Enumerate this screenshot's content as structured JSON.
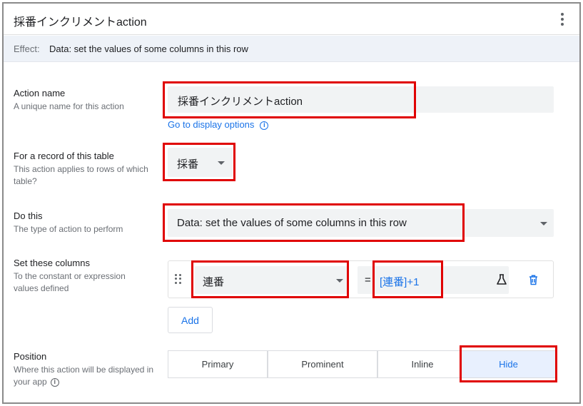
{
  "header": {
    "title": "採番インクリメントaction"
  },
  "effect": {
    "label": "Effect:",
    "value": "Data: set the values of some columns in this row"
  },
  "action_name": {
    "title": "Action name",
    "desc": "A unique name for this action",
    "value": "採番インクリメントaction",
    "link": "Go to display options",
    "link_icon": "info-icon"
  },
  "table": {
    "title": "For a record of this table",
    "desc": "This action applies to rows of which table?",
    "value": "採番"
  },
  "do_this": {
    "title": "Do this",
    "desc": "The type of action to perform",
    "value": "Data: set the values of some columns in this row"
  },
  "set_columns": {
    "title": "Set these columns",
    "desc": "To the constant or expression values defined",
    "column": "連番",
    "equals": "=",
    "expression": "[連番]+1",
    "expression_color": "#1a73e8",
    "add_label": "Add"
  },
  "position": {
    "title": "Position",
    "desc": "Where this action will be displayed in your app",
    "options": [
      "Primary",
      "Prominent",
      "Inline",
      "Hide"
    ],
    "selected": "Hide"
  },
  "colors": {
    "highlight": "#e00000",
    "accent": "#1a73e8",
    "field_bg": "#f1f3f4"
  }
}
